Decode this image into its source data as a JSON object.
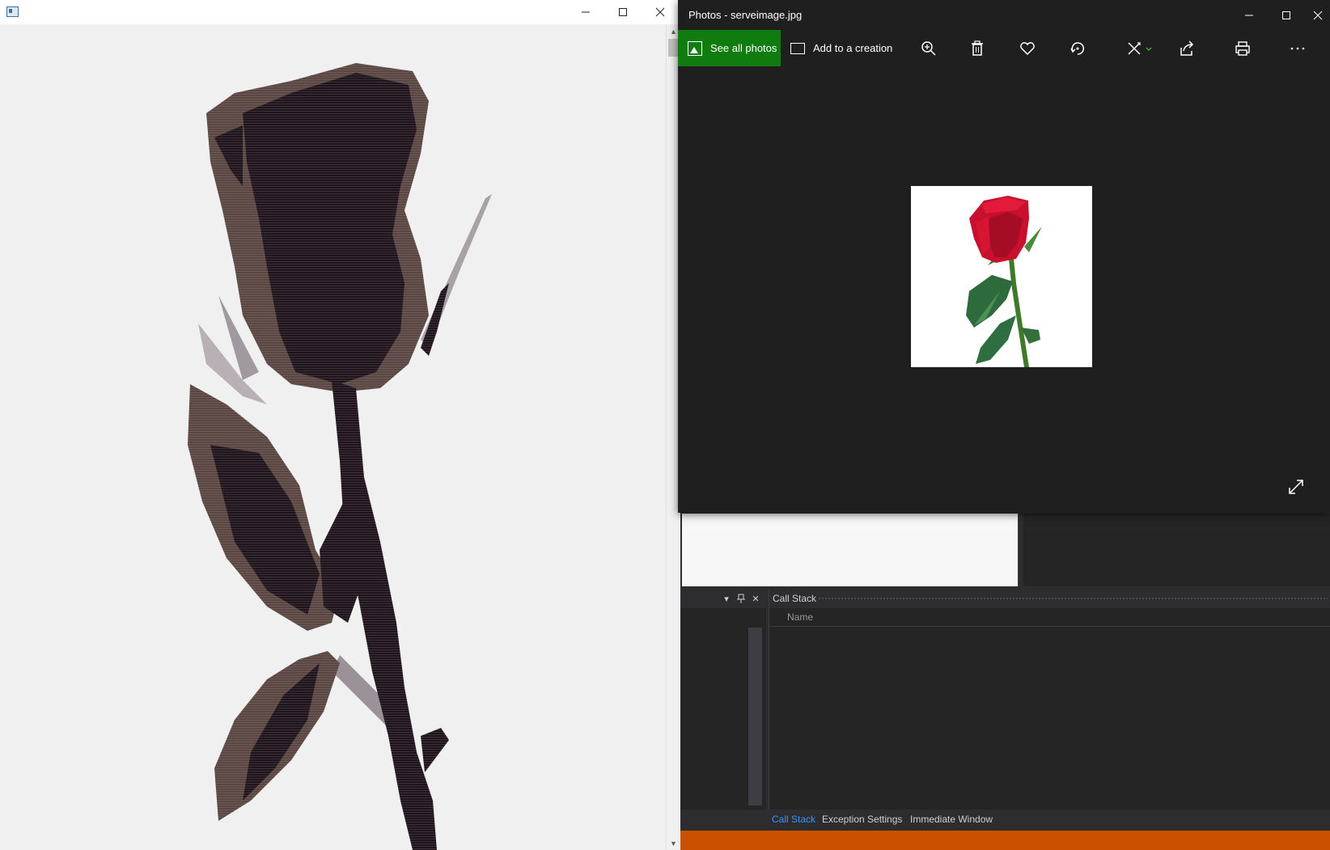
{
  "photos_window": {
    "title": "Photos - serveimage.jpg",
    "toolbar": {
      "see_all_label": "See all photos",
      "add_creation_label": "Add to a creation",
      "icons": [
        "zoom-in-icon",
        "delete-icon",
        "heart-icon",
        "rotate-icon",
        "edit-icon",
        "share-icon",
        "print-icon",
        "more-icon"
      ]
    },
    "accent": "#107c10"
  },
  "ide": {
    "callstack_title": "Call Stack",
    "callstack_column": "Name",
    "tabs": [
      {
        "label": "Call Stack",
        "active": true
      },
      {
        "label": "Exception Settings",
        "active": false
      },
      {
        "label": "Immediate Window",
        "active": false
      }
    ],
    "status_bar_color": "#ca5100",
    "active_tab_color": "#3794ff"
  }
}
